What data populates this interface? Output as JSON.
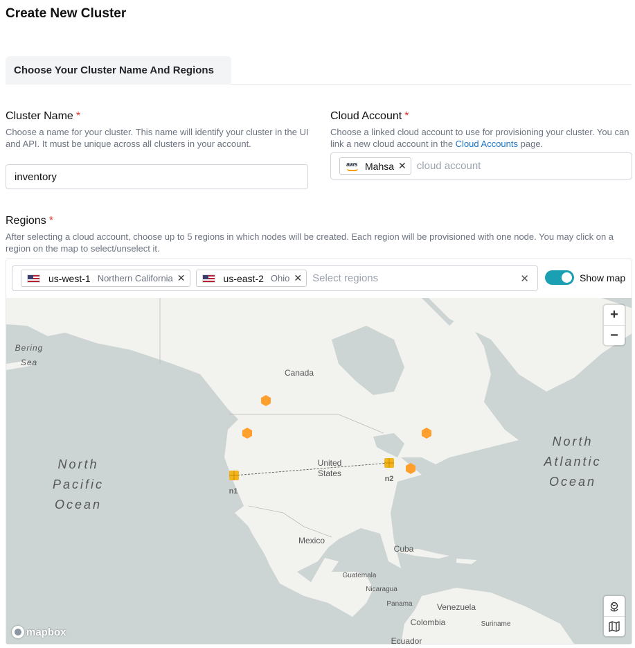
{
  "page_title": "Create New Cluster",
  "tabs": [
    {
      "label": "Choose Your Cluster Name And Regions"
    }
  ],
  "cluster_name": {
    "label": "Cluster Name",
    "required_mark": "*",
    "help": "Choose a name for your cluster. This name will identify your cluster in the UI and API. It must be unique across all clusters in your account.",
    "value": "inventory"
  },
  "cloud_account": {
    "label": "Cloud Account",
    "required_mark": "*",
    "help_prefix": "Choose a linked cloud account to use for provisioning your cluster. You can link a new cloud account in the ",
    "help_link": "Cloud Accounts",
    "help_suffix": " page.",
    "selected": {
      "logo_text": "aws",
      "name": "Mahsa",
      "icon": "aws-logo"
    },
    "placeholder": "cloud account"
  },
  "regions": {
    "label": "Regions",
    "required_mark": "*",
    "help": "After selecting a cloud account, choose up to 5 regions in which nodes will be created. Each region will be provisioned with one node. You may click on a region on the map to select/unselect it.",
    "selected": [
      {
        "code": "us-west-1",
        "name": "Northern California",
        "flag": "us-flag"
      },
      {
        "code": "us-east-2",
        "name": "Ohio",
        "flag": "us-flag"
      }
    ],
    "placeholder": "Select regions",
    "show_map_label": "Show map",
    "show_map_on": true
  },
  "map": {
    "labels": {
      "bering": "Bering",
      "sea": "Sea",
      "canada": "Canada",
      "united": "United",
      "states": "States",
      "mexico": "Mexico",
      "cuba": "Cuba",
      "guatemala": "Guatemala",
      "nicaragua": "Nicaragua",
      "panama": "Panama",
      "venezuela": "Venezuela",
      "colombia": "Colombia",
      "suriname": "Suriname",
      "ecuador": "Ecuador",
      "np_north": "North",
      "np_pacific": "Pacific",
      "np_ocean": "Ocean",
      "na_north": "North",
      "na_atlantic": "Atlantic",
      "na_ocean": "Ocean"
    },
    "nodes": [
      {
        "label": "n1"
      },
      {
        "label": "n2"
      }
    ],
    "zoom_in": "+",
    "zoom_out": "−",
    "attribution": "mapbox",
    "colors": {
      "land": "#f2f2ef",
      "water": "#ccd4d4",
      "region": "#ff9f2e",
      "node": "#f2b51c",
      "toggle": "#1a9fb3"
    }
  }
}
